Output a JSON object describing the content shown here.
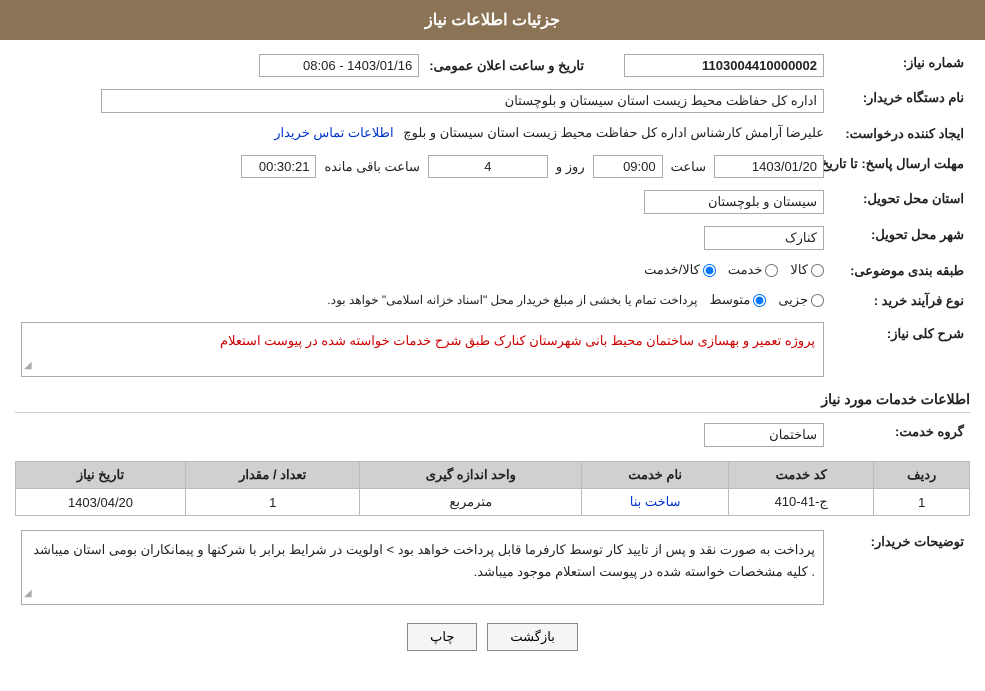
{
  "header": {
    "title": "جزئیات اطلاعات نیاز"
  },
  "fields": {
    "need_number_label": "شماره نیاز:",
    "need_number_value": "1103004410000002",
    "buyer_org_label": "نام دستگاه خریدار:",
    "buyer_org_value": "اداره کل حفاظت محیط زیست استان سیستان و بلوچستان",
    "creator_label": "ایجاد کننده درخواست:",
    "creator_value": "علیرضا آرامش کارشناس اداره کل حفاظت محیط زیست استان سیستان و بلوچ",
    "creator_link": "اطلاعات تماس خریدار",
    "date_label": "مهلت ارسال پاسخ: تا تاریخ:",
    "date_value": "1403/01/20",
    "time_label": "ساعت",
    "time_value": "09:00",
    "days_label": "روز و",
    "days_value": "4",
    "remaining_label": "ساعت باقی مانده",
    "remaining_value": "00:30:21",
    "announce_date_label": "تاریخ و ساعت اعلان عمومی:",
    "announce_date_value": "1403/01/16 - 08:06",
    "province_label": "استان محل تحویل:",
    "province_value": "سیستان و بلوچستان",
    "city_label": "شهر محل تحویل:",
    "city_value": "کنارک",
    "category_label": "طبقه بندی موضوعی:",
    "category_options": [
      "کالا",
      "خدمت",
      "کالا/خدمت"
    ],
    "category_selected": "کالا/خدمت",
    "process_label": "نوع فرآیند خرید :",
    "process_options": [
      "جزیی",
      "متوسط"
    ],
    "process_note": "پرداخت تمام یا بخشی از مبلغ خریدار محل \"اسناد خزانه اسلامی\" خواهد بود.",
    "description_label": "شرح کلی نیاز:",
    "description_value": "پروژه تعمیر و بهسازی ساختمان محیط بانی شهرستان کنارک طبق شرح خدمات خواسته شده در پیوست استعلام",
    "services_section_label": "اطلاعات خدمات مورد نیاز",
    "group_service_label": "گروه خدمت:",
    "group_service_value": "ساختمان",
    "table": {
      "headers": [
        "ردیف",
        "کد خدمت",
        "نام خدمت",
        "واحد اندازه گیری",
        "تعداد / مقدار",
        "تاریخ نیاز"
      ],
      "rows": [
        {
          "row": "1",
          "code": "ج-41-410",
          "name": "ساخت بنا",
          "unit": "مترمربع",
          "quantity": "1",
          "date": "1403/04/20"
        }
      ]
    },
    "buyer_notes_label": "توضیحات خریدار:",
    "buyer_notes_value": "پرداخت به صورت نقد و پس از تایید کار توسط کارفرما قابل پرداخت خواهد بود > اولویت در شرایط برابر با شرکتها و پیمانکاران بومی استان میباشد . کلیه مشخصات خواسته شده در پیوست استعلام موجود میباشد."
  },
  "buttons": {
    "back_label": "بازگشت",
    "print_label": "چاپ"
  }
}
